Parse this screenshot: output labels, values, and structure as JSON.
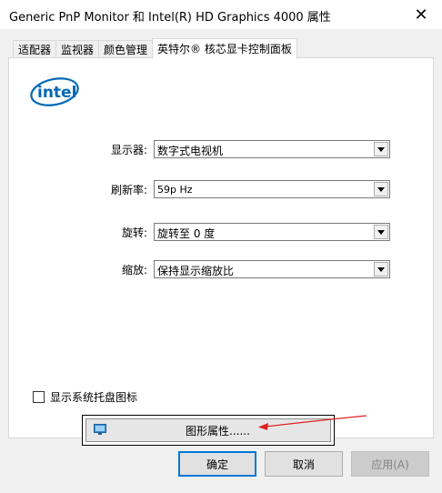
{
  "window": {
    "title": "Generic PnP Monitor 和 Intel(R) HD Graphics 4000 属性",
    "close_glyph": "✕"
  },
  "tabs": [
    {
      "label": "适配器"
    },
    {
      "label": "监视器"
    },
    {
      "label": "颜色管理"
    },
    {
      "label": "英特尔® 核芯显卡控制面板",
      "active": true
    }
  ],
  "logo": {
    "text": "intel",
    "color": "#0068b5"
  },
  "settings": {
    "display": {
      "label": "显示器:",
      "value": "数字式电视机"
    },
    "refresh": {
      "label": "刷新率:",
      "value": "59p Hz"
    },
    "rotation": {
      "label": "旋转:",
      "value": "旋转至 0 度"
    },
    "scaling": {
      "label": "缩放:",
      "value": "保持显示缩放比"
    }
  },
  "tray_checkbox": {
    "label": "显示系统托盘图标",
    "checked": false
  },
  "graphics_button": {
    "label": "图形属性......"
  },
  "buttons": {
    "ok": "确定",
    "cancel": "取消",
    "apply": "应用(A)"
  },
  "colors": {
    "accent": "#0078d7",
    "annotation": "#e02020"
  }
}
